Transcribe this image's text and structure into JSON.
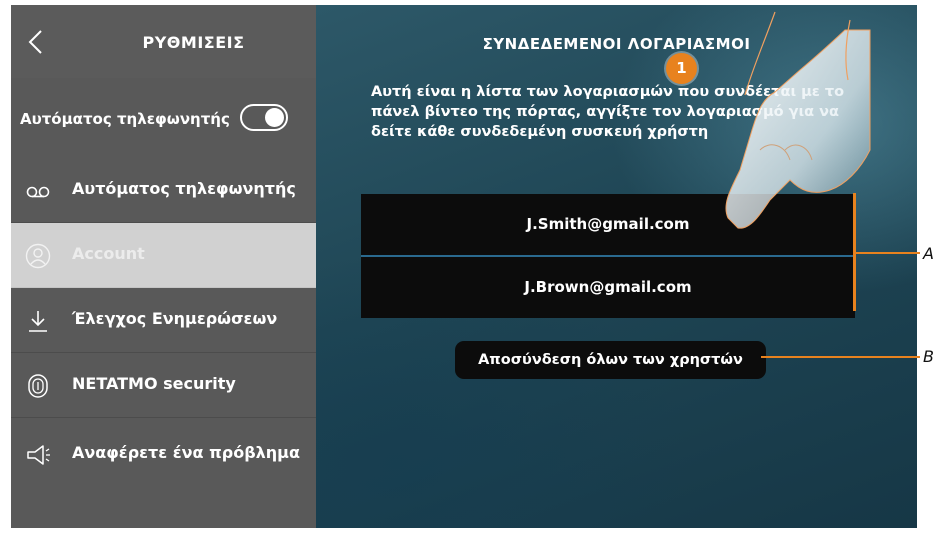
{
  "sidebar": {
    "title": "ΡΥΘΜΙΣΕΙΣ",
    "toggle_label": "Αυτόματος τηλεφωνητής",
    "toggle_on": true,
    "items": [
      {
        "label": "Αυτόματος τηλεφωνητής",
        "icon": "voicemail-icon"
      },
      {
        "label": "Account",
        "icon": "user-icon",
        "active": true
      },
      {
        "label": "Έλεγχος Ενημερώσεων",
        "icon": "download-icon"
      },
      {
        "label": "NETATMO security",
        "icon": "fingerprint-icon"
      },
      {
        "label": "Αναφέρετε ένα πρόβλημα",
        "icon": "megaphone-icon"
      }
    ]
  },
  "main": {
    "title": "ΣΥΝΔΕΔΕΜΕΝΟΙ ΛΟΓΑΡΙΑΣΜΟΙ",
    "description": "Αυτή είναι η λίστα των λογαριασμών που συνδέεται με το πάνελ βίντεο της πόρτας, αγγίξτε τον λογαριασμό για να δείτε κάθε συνδεδεμένη συσκευή χρήστη",
    "accounts": [
      "J.Smith@gmail.com",
      "J.Brown@gmail.com"
    ],
    "disconnect_all_label": "Αποσύνδεση όλων των χρηστών"
  },
  "annotations": {
    "step_number": "1",
    "label_a": "A",
    "label_b": "B"
  },
  "colors": {
    "sidebar_bg": "#595959",
    "active_item_bg": "#d1d1d1",
    "list_bg": "#0c0c0c",
    "accent": "#e8821e"
  }
}
